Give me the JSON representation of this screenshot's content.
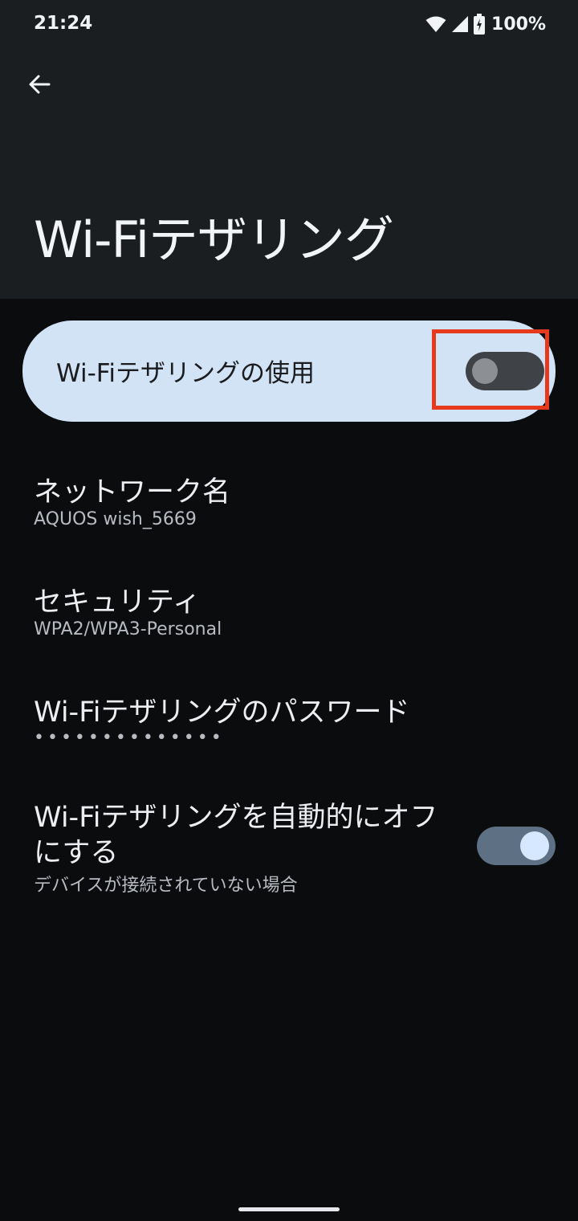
{
  "status_bar": {
    "time": "21:24",
    "battery_percent": "100%",
    "icons": [
      "wifi-icon",
      "cell-signal-icon",
      "battery-charging-icon"
    ]
  },
  "header": {
    "back_icon": "arrow-back-icon",
    "title": "Wi-Fiテザリング"
  },
  "main_switch": {
    "label": "Wi-Fiテザリングの使用",
    "enabled": false
  },
  "preferences": {
    "network_name": {
      "title": "ネットワーク名",
      "summary": "AQUOS wish_5669"
    },
    "security": {
      "title": "セキュリティ",
      "summary": "WPA2/WPA3-Personal"
    },
    "password": {
      "title": "Wi-Fiテザリングのパスワード",
      "summary": "••••••••••••••"
    },
    "auto_off": {
      "title": "Wi-Fiテザリングを自動的にオフにする",
      "summary": "デバイスが接続されていない場合",
      "enabled": true
    }
  },
  "colors": {
    "header_bg": "#1b1e21",
    "body_bg": "#0b0c0e",
    "card_bg": "#d3e3f6",
    "highlight": "#e53a1e",
    "toggle_on_track": "#5e7084",
    "toggle_on_thumb": "#d6e8ff"
  }
}
